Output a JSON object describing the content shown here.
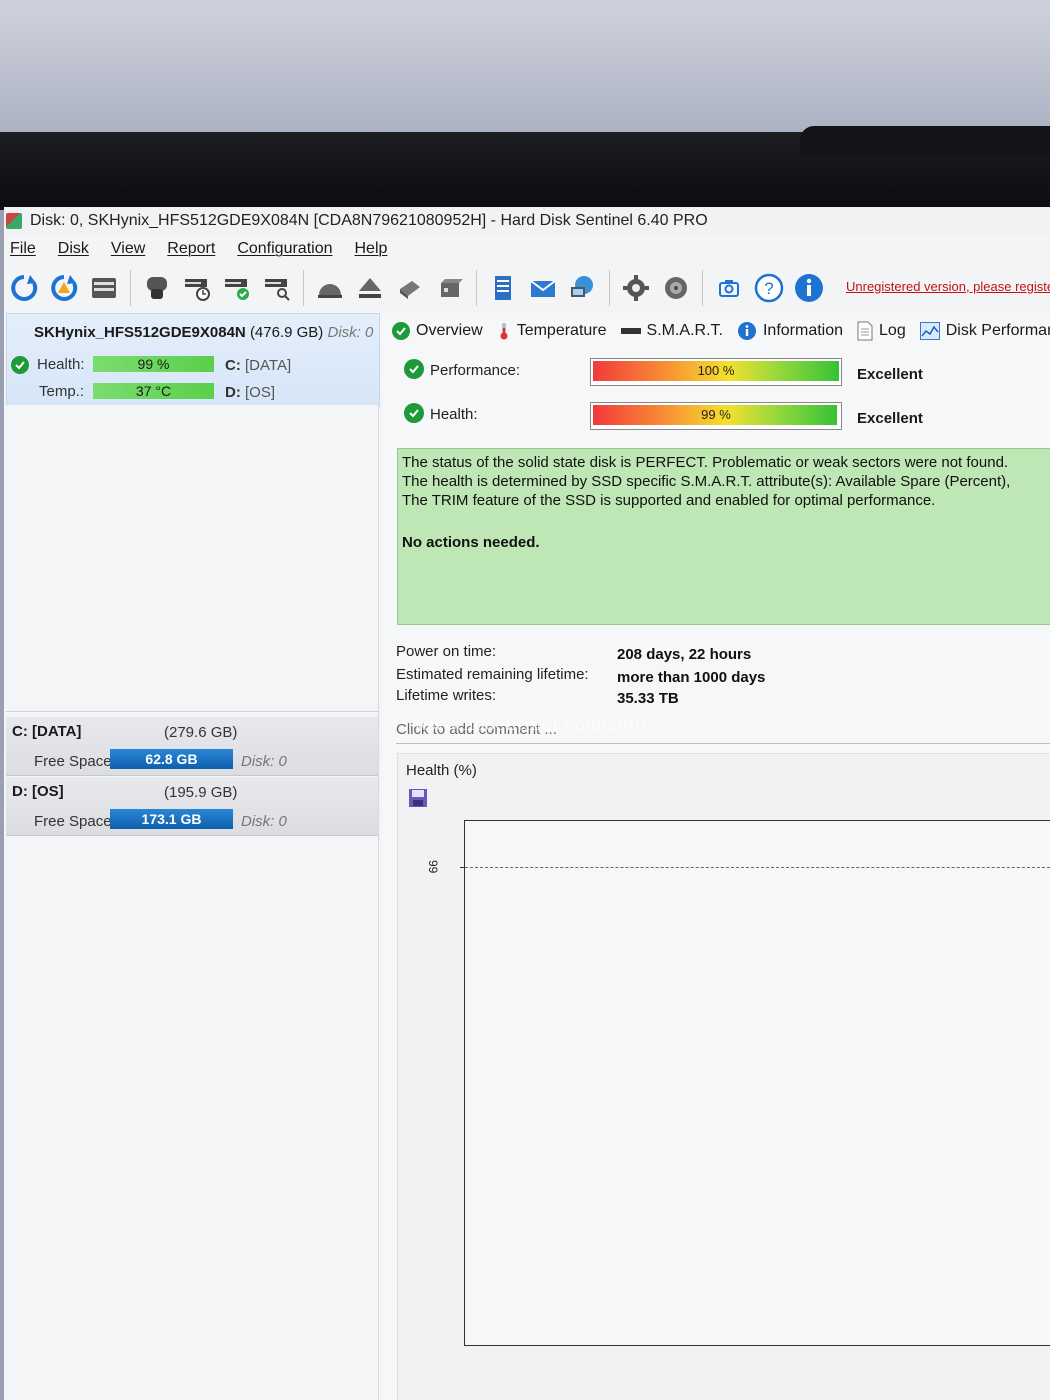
{
  "window": {
    "title": "Disk: 0, SKHynix_HFS512GDE9X084N [CDA8N79621080952H]  -  Hard Disk Sentinel 6.40 PRO"
  },
  "menu": {
    "items": [
      "File",
      "Disk",
      "View",
      "Report",
      "Configuration",
      "Help"
    ]
  },
  "toolbar": {
    "icons": [
      "refresh-icon",
      "refresh-warning-icon",
      "disk-drive-icon",
      "mouse-icon",
      "disk-clock-icon",
      "disk-check-icon",
      "disk-search-icon",
      "helmet-icon",
      "eject-icon",
      "usb-drive-icon",
      "external-drive-icon",
      "notepad-icon",
      "email-icon",
      "network-icon",
      "gear-icon",
      "speaker-icon",
      "camera-icon",
      "help-icon",
      "info-icon"
    ],
    "unregistered_text": "Unregistered version, please register"
  },
  "disk": {
    "name": "SKHynix_HFS512GDE9X084N",
    "size": "(476.9 GB)",
    "disk_label": "Disk: 0",
    "health_label": "Health:",
    "health_value": "99 %",
    "temp_label": "Temp.:",
    "temp_value": "37 °C",
    "partition_c": "C:",
    "partition_c_name": "[DATA]",
    "partition_d": "D:",
    "partition_d_name": "[OS]"
  },
  "volumes": [
    {
      "name": "C: [DATA]",
      "size": "(279.6 GB)",
      "free_label": "Free Space",
      "free": "62.8 GB",
      "disk": "Disk: 0"
    },
    {
      "name": "D: [OS]",
      "size": "(195.9 GB)",
      "free_label": "Free Space",
      "free": "173.1 GB",
      "disk": "Disk: 0"
    }
  ],
  "tabs": [
    "Overview",
    "Temperature",
    "S.M.A.R.T.",
    "Information",
    "Log",
    "Disk Performance"
  ],
  "overview": {
    "performance_label": "Performance:",
    "performance_value": "100 %",
    "performance_pct": 100,
    "performance_rating": "Excellent",
    "health_label": "Health:",
    "health_value": "99 %",
    "health_pct": 99,
    "health_rating": "Excellent",
    "status_lines": [
      "The status of the solid state disk is PERFECT. Problematic or weak sectors were not found.",
      "The health is determined by SSD specific S.M.A.R.T. attribute(s):  Available Spare (Percent),",
      "The TRIM feature of the SSD is supported and enabled for optimal performance."
    ],
    "status_action": "No actions needed.",
    "power_on_label": "Power on time:",
    "power_on_value": "208 days, 22 hours",
    "lifetime_label": "Estimated remaining lifetime:",
    "lifetime_value": "more than 1000 days",
    "writes_label": "Lifetime writes:",
    "writes_value": "35.33 TB",
    "comment_placeholder": "Click to add comment ..."
  },
  "health_chart": {
    "title": "Health (%)",
    "y_tick": "99"
  },
  "watermark": "www.hdsentinel.com/soto",
  "colors": {
    "status_green": "#bfe6b5",
    "volume_bar_blue": "#1570c2",
    "unregistered_red": "#c21313"
  }
}
